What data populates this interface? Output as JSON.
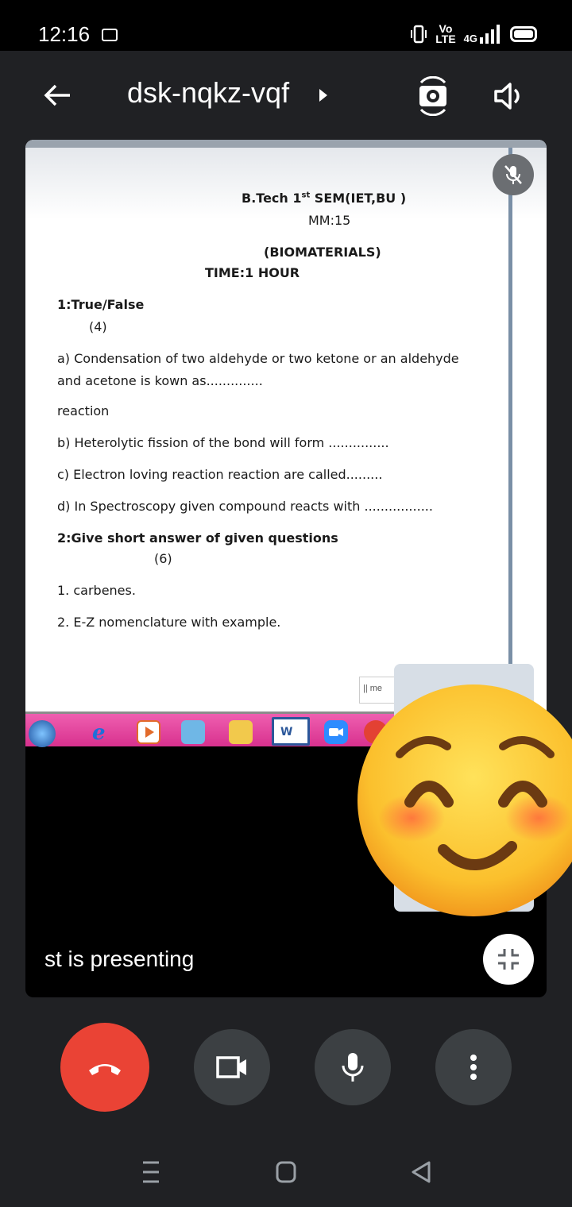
{
  "status_bar": {
    "time": "12:16",
    "network_label_top": "Vo",
    "network_label_bottom": "LTE",
    "signal_label": "4G"
  },
  "header": {
    "meeting_code": "dsk-nqkz-vqf"
  },
  "document": {
    "title_line": "B.Tech 1",
    "title_sup": "st",
    "title_rest": " SEM(IET,BU )",
    "marks": "MM:15",
    "subject": "(BIOMATERIALS)",
    "time": "TIME:1 HOUR",
    "section1_heading": "1:True/False",
    "section1_marks": "(4)",
    "q_a_line1": "a)  Condensation of two aldehyde or two ketone or an aldehyde",
    "q_a_line2": "and acetone is kown as..............",
    "q_a_line3": "reaction",
    "q_b": "b) Heterolytic fission of the bond will form ...............",
    "q_c": "c) Electron loving reaction reaction are called.........",
    "q_d": "d) In Spectroscopy given compound reacts with   .................",
    "section2_heading": "2:Give short answer of given questions",
    "section2_marks": "(6)",
    "item1": "1. carbenes.",
    "item2": "2. E-Z nomenclature with example.",
    "mini_chip": "|| me"
  },
  "stage": {
    "presenting_label": "st is presenting"
  },
  "icons": {
    "back": "arrow-left-icon",
    "switch_camera": "switch-camera-icon",
    "speaker": "speaker-icon",
    "mic_off": "mic-off-icon",
    "collapse": "collapse-icon",
    "end_call": "end-call-icon",
    "camera": "camera-icon",
    "mic": "mic-icon",
    "more": "more-vertical-icon"
  },
  "colors": {
    "end_call": "#ea4335",
    "control_bg": "#3c4043",
    "background": "#202124",
    "taskbar": "#d8318e"
  }
}
